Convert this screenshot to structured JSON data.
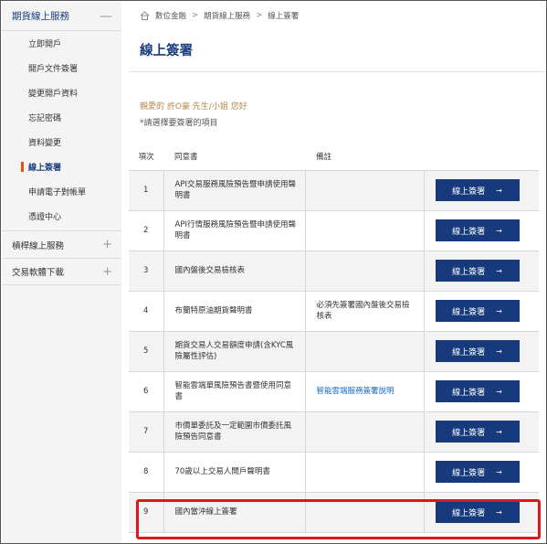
{
  "sidebar": {
    "header": {
      "label": "期貨線上服務",
      "toggle": "—"
    },
    "items": [
      {
        "label": "立即開戶",
        "active": false
      },
      {
        "label": "開戶文件簽署",
        "active": false
      },
      {
        "label": "變更開戶資料",
        "active": false
      },
      {
        "label": "忘記密碼",
        "active": false
      },
      {
        "label": "資料變更",
        "active": false
      },
      {
        "label": "線上簽署",
        "active": true
      },
      {
        "label": "申請電子對帳單",
        "active": false
      },
      {
        "label": "憑證中心",
        "active": false
      }
    ],
    "sections": [
      {
        "label": "槓桿線上服務",
        "toggle": "+"
      },
      {
        "label": "交易軟體下載",
        "toggle": "+"
      }
    ]
  },
  "breadcrumb": {
    "home": "數位金融",
    "level2": "期貨線上服務",
    "level3": "線上簽署",
    "sep": ">"
  },
  "page": {
    "title": "線上簽署",
    "greeting": "親愛的 許O豪 先生/小姐 您好",
    "instruction": "*請選擇要簽署的項目"
  },
  "table": {
    "headers": {
      "no": "項次",
      "doc": "同意書",
      "note": "備註",
      "action": ""
    },
    "button_label": "線上簽署",
    "rows": [
      {
        "no": "1",
        "doc": "API交易服務風險預告暨申請使用聲明書",
        "note": "",
        "note_link": false
      },
      {
        "no": "2",
        "doc": "API行情服務風險預告暨申請使用聲明書",
        "note": "",
        "note_link": false
      },
      {
        "no": "3",
        "doc": "國內盤後交易檢核表",
        "note": "",
        "note_link": false
      },
      {
        "no": "4",
        "doc": "布蘭特原油期貨聲明書",
        "note": "必須先簽署國內盤後交易檢核表",
        "note_link": false
      },
      {
        "no": "5",
        "doc": "期貨交易人交易額度申請(含KYC風險屬性評估)",
        "note": "",
        "note_link": false
      },
      {
        "no": "6",
        "doc": "智能雲端單風險預告書暨使用同意書",
        "note": "智能雲端服務簽署說明",
        "note_link": true
      },
      {
        "no": "7",
        "doc": "市價單委託及一定範圍市價委託風險預告同意書",
        "note": "",
        "note_link": false
      },
      {
        "no": "8",
        "doc": "70歲以上交易人開戶聲明書",
        "note": "",
        "note_link": false
      },
      {
        "no": "9",
        "doc": "國內當沖線上簽署",
        "note": "",
        "note_link": false
      }
    ]
  },
  "highlight": {
    "color": "#e0151b",
    "row": "9"
  },
  "colors": {
    "primary": "#173a7d",
    "accent": "#e8500e",
    "greeting": "#b5874b",
    "link": "#1a6cc4"
  }
}
